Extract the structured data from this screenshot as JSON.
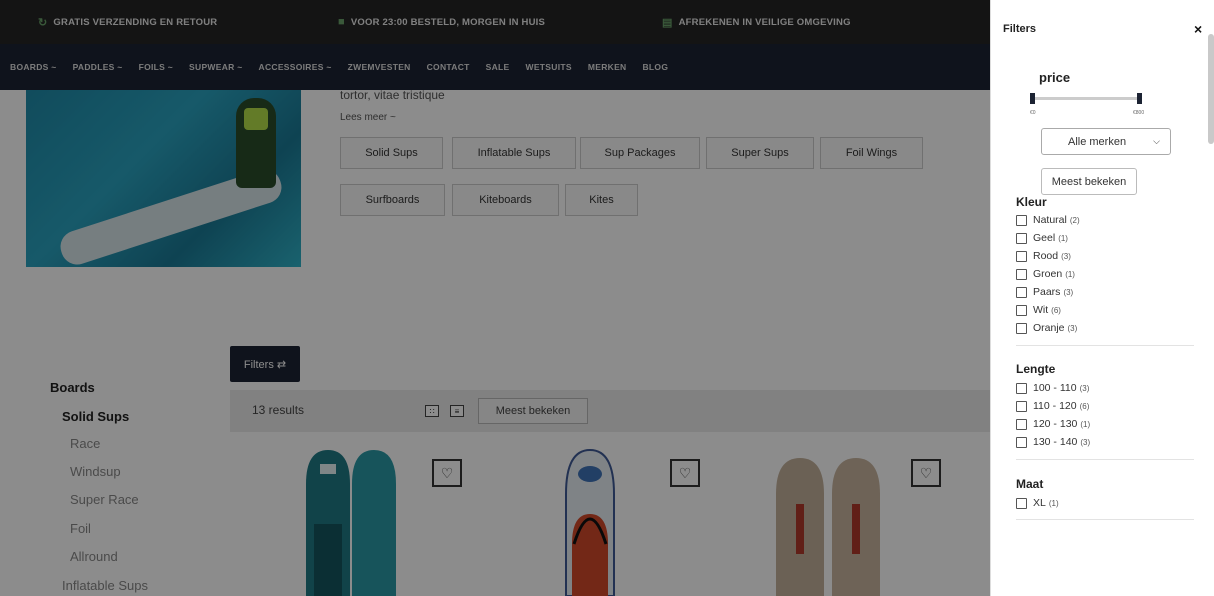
{
  "promo": {
    "items": [
      {
        "icon": "refresh-icon",
        "text": "GRATIS VERZENDING EN RETOUR"
      },
      {
        "icon": "truck-icon",
        "text": "VOOR 23:00 BESTELD, MORGEN IN HUIS"
      },
      {
        "icon": "cart-icon",
        "text": "AFREKENEN IN VEILIGE OMGEVING"
      }
    ]
  },
  "nav": {
    "items": [
      "BOARDS ~",
      "PADDLES ~",
      "FOILS ~",
      "SUPWEAR ~",
      "ACCESSOIRES ~",
      "ZWEMVESTEN",
      "CONTACT",
      "SALE",
      "WETSUITS",
      "MERKEN",
      "BLOG"
    ]
  },
  "hero": {
    "text": "tortor, vitae tristique",
    "more": "Lees meer ~"
  },
  "categories": [
    "Solid Sups",
    "Inflatable Sups",
    "Sup Packages",
    "Super Sups",
    "Foil Wings",
    "Surfboards",
    "Kiteboards",
    "Kites"
  ],
  "sidebar": {
    "title": "Boards",
    "items": [
      "Solid Sups",
      "Race",
      "Windsup",
      "Super Race",
      "Foil",
      "Allround",
      "Inflatable Sups"
    ]
  },
  "listing": {
    "filters_label": "Filters ⇄",
    "results": "13 results",
    "sort": "Meest bekeken"
  },
  "panel": {
    "title": "Filters",
    "close": "×",
    "price_title": "price",
    "price_min": "€0",
    "price_max": "€800",
    "brand_select": "Alle merken",
    "sort_button": "Meest bekeken",
    "kleur": {
      "title": "Kleur",
      "options": [
        {
          "label": "Natural",
          "count": "(2)"
        },
        {
          "label": "Geel",
          "count": "(1)"
        },
        {
          "label": "Rood",
          "count": "(3)"
        },
        {
          "label": "Groen",
          "count": "(1)"
        },
        {
          "label": "Paars",
          "count": "(3)"
        },
        {
          "label": "Wit",
          "count": "(6)"
        },
        {
          "label": "Oranje",
          "count": "(3)"
        }
      ]
    },
    "lengte": {
      "title": "Lengte",
      "options": [
        {
          "label": "100 - 110",
          "count": "(3)"
        },
        {
          "label": "110 - 120",
          "count": "(6)"
        },
        {
          "label": "120 - 130",
          "count": "(1)"
        },
        {
          "label": "130 - 140",
          "count": "(3)"
        }
      ]
    },
    "maat": {
      "title": "Maat",
      "options": [
        {
          "label": "XL",
          "count": "(1)"
        }
      ]
    }
  },
  "colors": {
    "nav_bg": "#1c2333",
    "promo_bg": "#262626",
    "accent": "#1c2333"
  }
}
